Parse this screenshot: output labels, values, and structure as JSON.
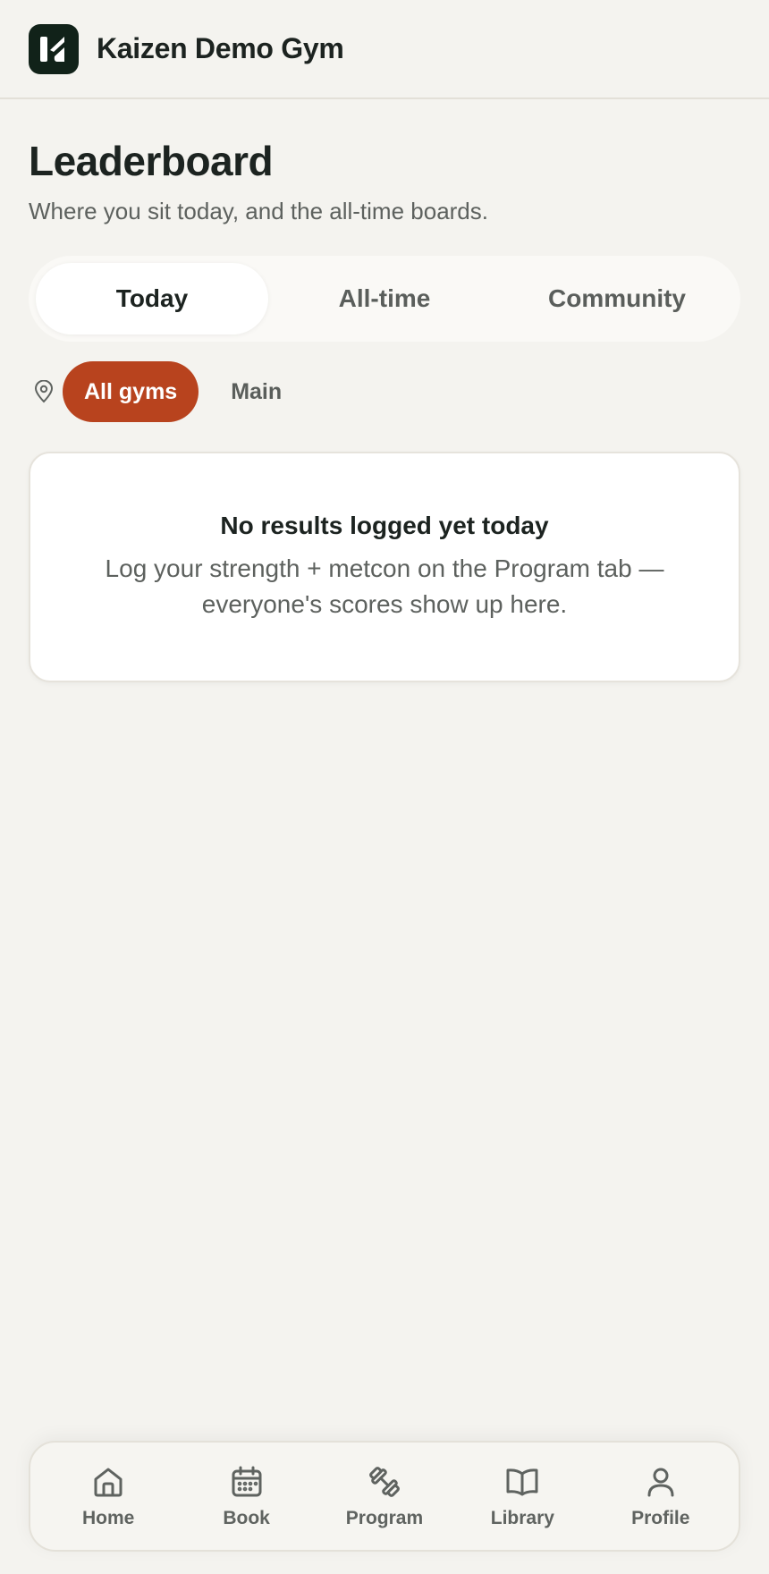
{
  "header": {
    "brand": "Kaizen Demo Gym",
    "logo_icon": "kaizen-logo-icon"
  },
  "page": {
    "title": "Leaderboard",
    "subtitle": "Where you sit today, and the all-time boards."
  },
  "segments": [
    {
      "label": "Today",
      "active": true
    },
    {
      "label": "All-time",
      "active": false
    },
    {
      "label": "Community",
      "active": false
    }
  ],
  "gym_filter": {
    "icon": "location-pin-icon",
    "options": [
      {
        "label": "All gyms",
        "active": true
      },
      {
        "label": "Main",
        "active": false
      }
    ]
  },
  "empty_state": {
    "title": "No results logged yet today",
    "body": "Log your strength + metcon on the Program tab — everyone's scores show up here."
  },
  "bottom_nav": [
    {
      "label": "Home",
      "icon": "home-icon"
    },
    {
      "label": "Book",
      "icon": "calendar-icon"
    },
    {
      "label": "Program",
      "icon": "dumbbell-icon"
    },
    {
      "label": "Library",
      "icon": "book-open-icon"
    },
    {
      "label": "Profile",
      "icon": "user-icon"
    }
  ],
  "colors": {
    "background": "#f4f3ef",
    "accent": "#b8431e",
    "logo_bg": "#112219",
    "text": "#1c2320",
    "muted_text": "#5d615e"
  }
}
